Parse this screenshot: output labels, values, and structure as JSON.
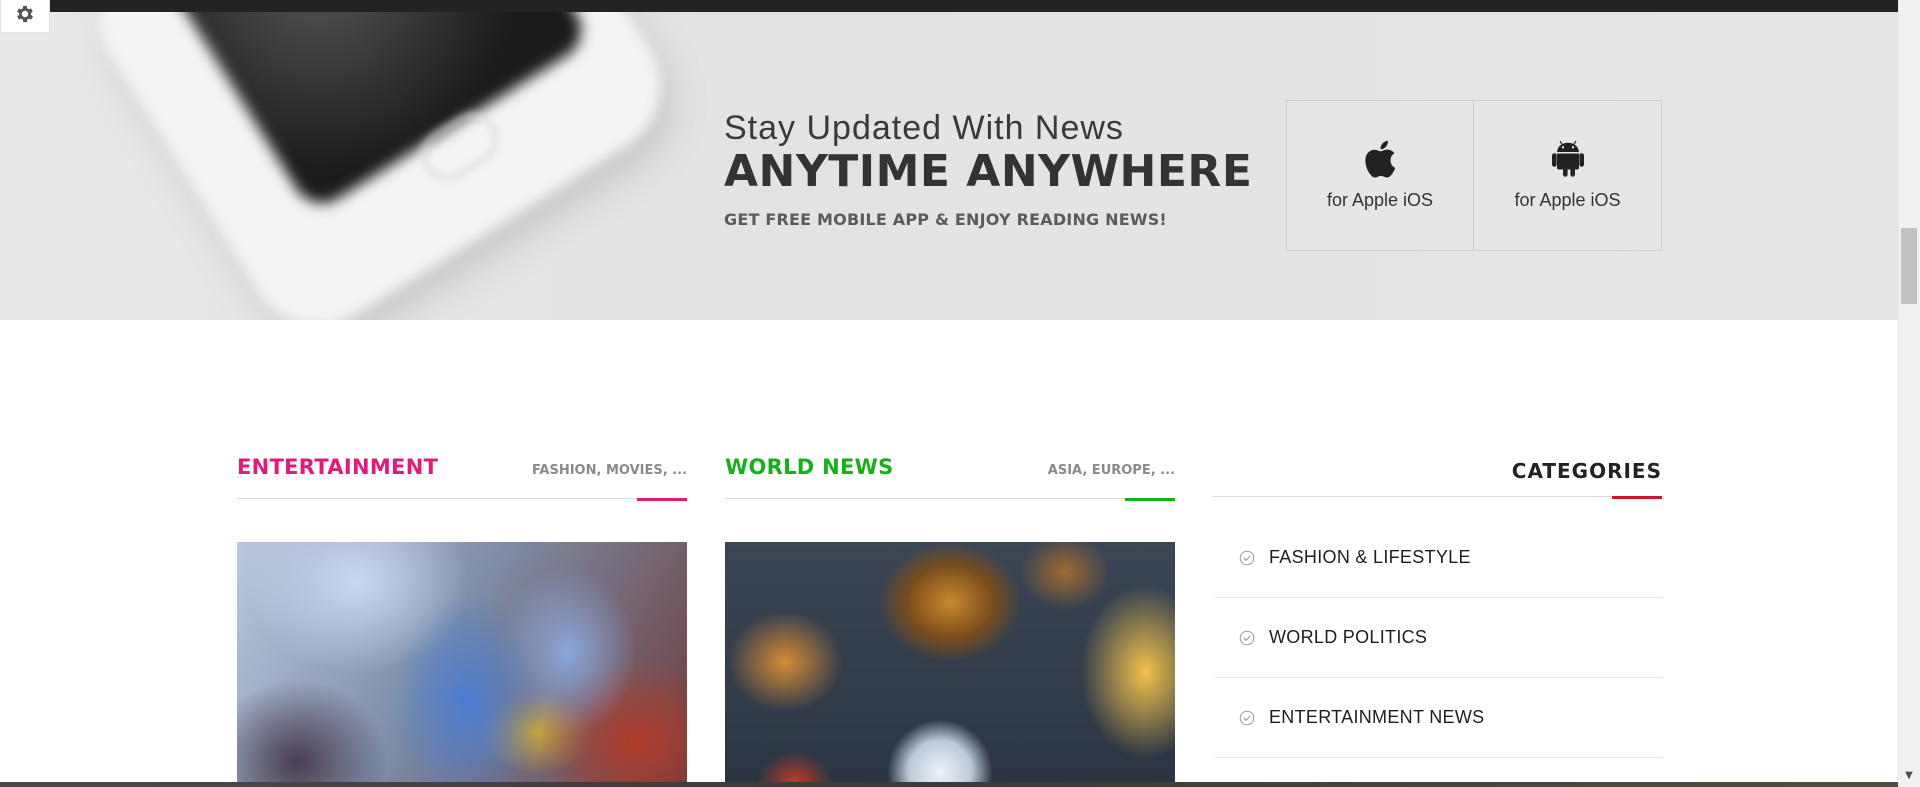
{
  "banner": {
    "line1": "Stay Updated With News",
    "line2": "ANYTIME ANYWHERE",
    "line3": "GET FREE MOBILE APP & ENJOY READING NEWS!",
    "app_buttons": [
      {
        "icon": "apple-icon",
        "label": "for Apple iOS"
      },
      {
        "icon": "android-icon",
        "label": "for Apple iOS"
      }
    ]
  },
  "settings": {
    "icon": "gear-icon"
  },
  "sections": {
    "entertainment": {
      "title": "ENTERTAINMENT",
      "tags": "FASHION, MOVIES, ...",
      "accent": "#e4197c"
    },
    "world_news": {
      "title": "WORLD NEWS",
      "tags": "ASIA, EUROPE, ...",
      "accent": "#16b11a"
    },
    "categories": {
      "title": "CATEGORIES",
      "accent": "#d0142a",
      "items": [
        {
          "icon": "check-circle-icon",
          "label": "FASHION & LIFESTYLE"
        },
        {
          "icon": "check-circle-icon",
          "label": "WORLD POLITICS"
        },
        {
          "icon": "check-circle-icon",
          "label": "ENTERTAINMENT NEWS"
        }
      ]
    }
  }
}
